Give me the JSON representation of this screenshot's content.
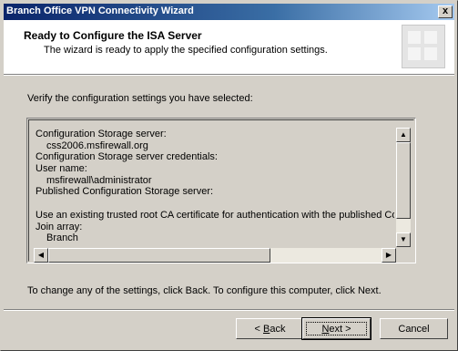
{
  "window": {
    "title": "Branch Office VPN Connectivity Wizard",
    "close_glyph": "x"
  },
  "header": {
    "title": "Ready to Configure the ISA Server",
    "subtitle": "The wizard is ready to apply the specified configuration settings.",
    "graphic": "wizard-banner-icon"
  },
  "main": {
    "intro": "Verify the configuration settings you have selected:",
    "settings_lines": [
      {
        "text": "Configuration Storage server:",
        "indent": false
      },
      {
        "text": "css2006.msfirewall.org",
        "indent": true
      },
      {
        "text": "Configuration Storage server credentials:",
        "indent": false
      },
      {
        "text": "User name:",
        "indent": false
      },
      {
        "text": "msfirewall\\administrator",
        "indent": true
      },
      {
        "text": "Published Configuration Storage server:",
        "indent": false
      },
      {
        "text": "",
        "indent": false
      },
      {
        "text": "Use an existing trusted root CA certificate for authentication with the published Configuration Storage server",
        "indent": false
      },
      {
        "text": "Join array:",
        "indent": false
      },
      {
        "text": "Branch",
        "indent": true
      }
    ],
    "footer_text": "To change any of the settings, click Back. To configure this computer, click Next."
  },
  "buttons": {
    "back": {
      "pre": "< ",
      "accel": "B",
      "post": "ack"
    },
    "next": {
      "pre": "",
      "accel": "N",
      "post": "ext >"
    },
    "cancel": "Cancel"
  },
  "colors": {
    "dialog_bg": "#d4d0c8",
    "titlebar_start": "#0a246a",
    "titlebar_end": "#a6caf0"
  }
}
